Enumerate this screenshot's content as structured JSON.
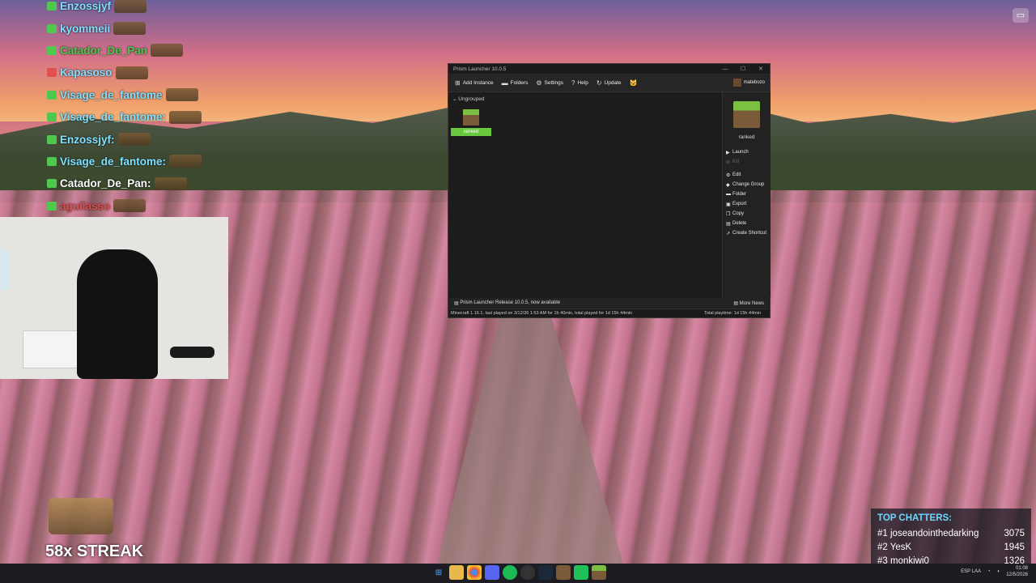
{
  "chat": [
    {
      "user": "Enzossjyf"
    },
    {
      "user": "kyommeii"
    },
    {
      "user": "Catador_De_Pan"
    },
    {
      "user": "Kapasoso"
    },
    {
      "user": "Visage_de_fantome"
    },
    {
      "user": "Visage_de_fantome:"
    },
    {
      "user": "Enzossjyf:"
    },
    {
      "user": "Visage_de_fantome:"
    },
    {
      "user": "Catador_De_Pan:"
    },
    {
      "user": "aguilasso"
    }
  ],
  "streak": "58x STREAK",
  "top_chatters": {
    "title": "TOP CHATTERS:",
    "rows": [
      {
        "rank": "#1",
        "name": "joseandointhedarking",
        "count": "3075"
      },
      {
        "rank": "#2",
        "name": "YesK",
        "count": "1945"
      },
      {
        "rank": "#3",
        "name": "monkiwi0",
        "count": "1326"
      }
    ]
  },
  "launcher": {
    "title": "Prism Launcher 10.0.5",
    "toolbar": {
      "add_instance": "Add Instance",
      "folders": "Folders",
      "settings": "Settings",
      "help": "Help",
      "update": "Update",
      "account": "matebozo"
    },
    "group": "Ungrouped",
    "instance": "ranked",
    "side": {
      "name": "ranked",
      "launch": "Launch",
      "kill": "Kill",
      "edit": "Edit",
      "change_group": "Change Group",
      "folder": "Folder",
      "export": "Export",
      "copy": "Copy",
      "delete": "Delete",
      "create_shortcut": "Create Shortcut"
    },
    "news": "Prism Launcher Release 10.0.5, now available",
    "more_news": "More News",
    "status": "Minecraft 1.16.1, last played on 3/12/26 1:53 AM for 1h 40min, total played for 1d 15h 44min",
    "total_playtime": "Total playtime: 1d 15h 44min"
  },
  "taskbar": {
    "lang": "ESP LAA",
    "time": "01:08",
    "date": "12/5/2026"
  }
}
